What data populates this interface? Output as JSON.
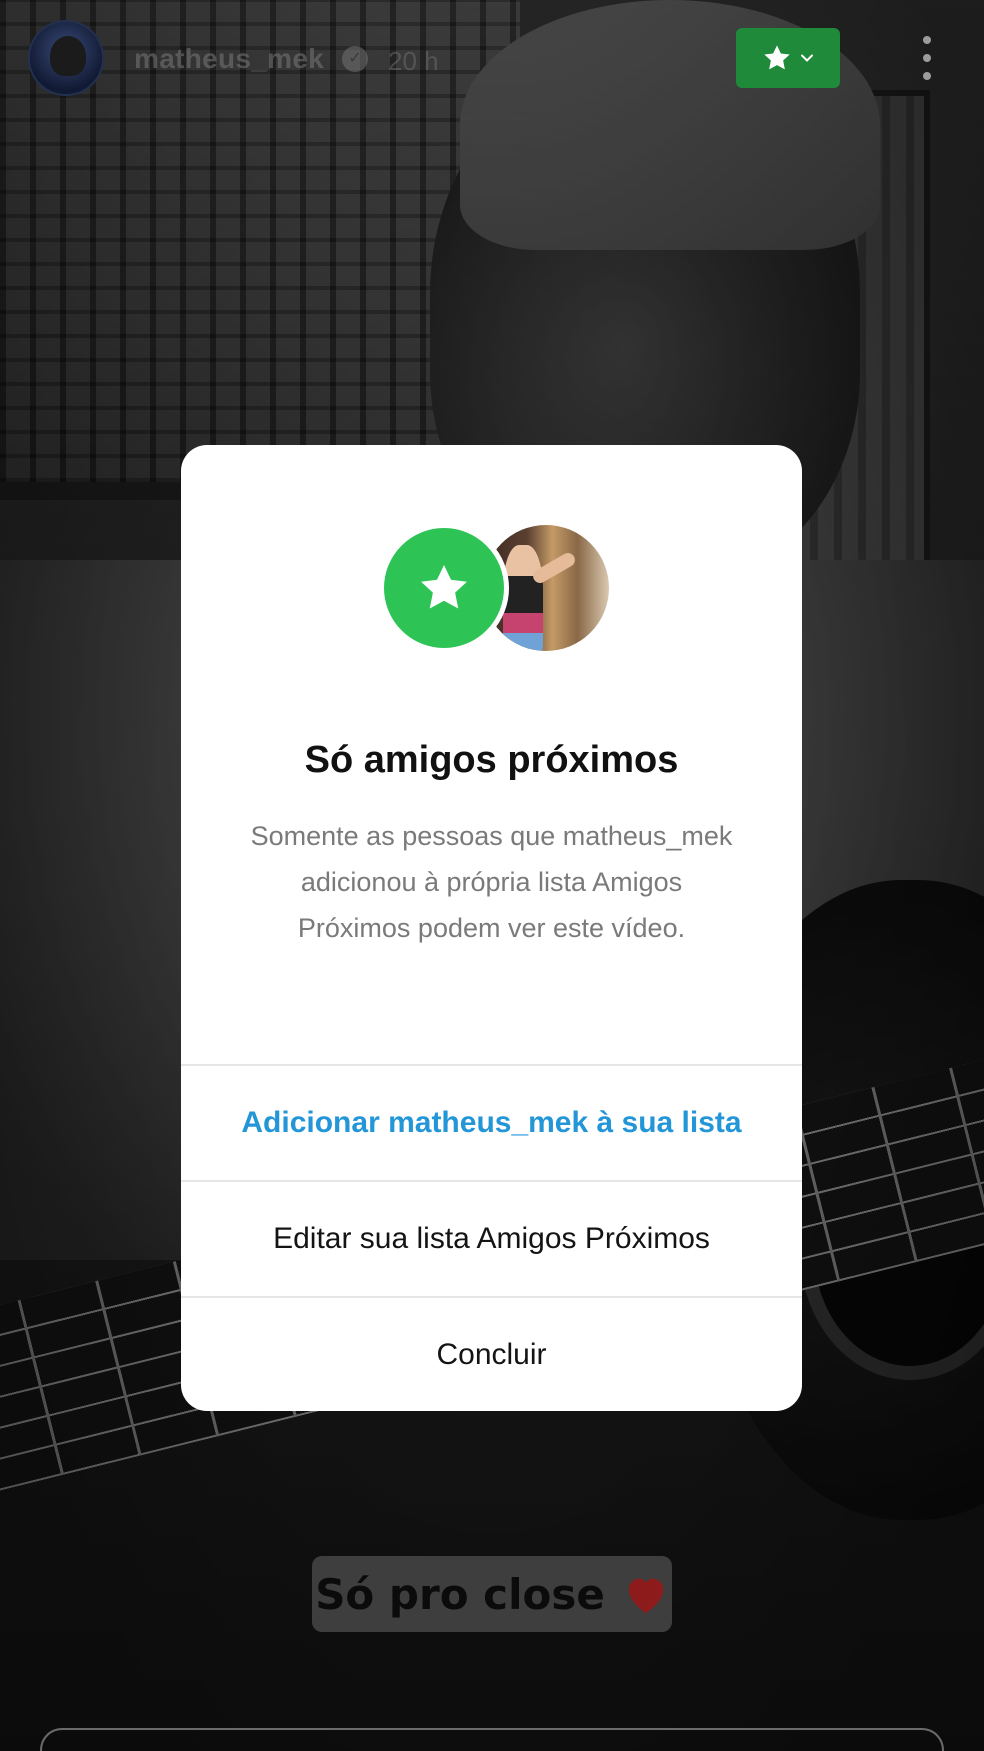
{
  "story": {
    "username": "matheus_mek",
    "timestamp": "20 h",
    "sticker_text": "Só pro close",
    "close_friends_color": "#1e8a3a"
  },
  "modal": {
    "title": "Só amigos próximos",
    "description": "Somente as pessoas que matheus_mek adicionou à própria lista Amigos Próximos podem ver este vídeo.",
    "buttons": {
      "add": "Adicionar matheus_mek à sua lista",
      "edit": "Editar sua lista Amigos Próximos",
      "done": "Concluir"
    },
    "accent_color": "#2396d8",
    "star_color": "#2ec455"
  },
  "icons": {
    "badge": "star-icon",
    "badge_dropdown": "chevron-down-icon",
    "menu": "more-vertical-icon",
    "verified": "verified-icon",
    "sticker_emoji": "heart-icon"
  }
}
